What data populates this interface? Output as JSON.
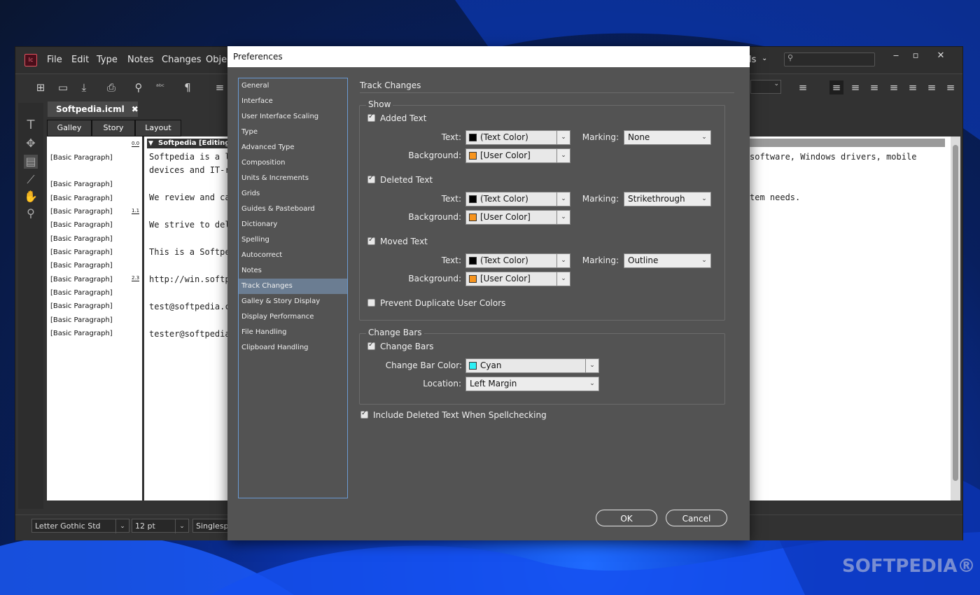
{
  "app": {
    "menu": [
      "File",
      "Edit",
      "Type",
      "Notes",
      "Changes",
      "Objec"
    ],
    "menu_right": "ls",
    "doc_tab": "Softpedia.icml",
    "view_tabs": [
      "Galley",
      "Story",
      "Layout"
    ]
  },
  "story": {
    "title": "Softpedia [Editing]",
    "styles": [
      "[Basic Paragraph]",
      "[Basic Paragraph]",
      "[Basic Paragraph]",
      "[Basic Paragraph]",
      "[Basic Paragraph]",
      "[Basic Paragraph]",
      "[Basic Paragraph]",
      "[Basic Paragraph]",
      "[Basic Paragraph]",
      "[Basic Paragraph]",
      "[Basic Paragraph]",
      "[Basic Paragraph]",
      "[Basic Paragraph]",
      "[Basic Paragraph]"
    ],
    "ruler_marks": [
      "0.0",
      "1.1",
      "2.3"
    ],
    "lines": [
      "Softpedia is a l",
      "devices and IT-r",
      "We review and ca",
      "We strive to del",
      "This is a Softpe",
      "http://win.softp",
      "test@softpedia.c",
      "tester@softpedia"
    ],
    "right_line_1": "software, Windows drivers, mobile",
    "right_line_2": "tem needs."
  },
  "statusbar": {
    "font": "Letter Gothic Std",
    "size": "12 pt",
    "spacing": "Singlespac"
  },
  "dialog": {
    "title": "Preferences",
    "categories": [
      "General",
      "Interface",
      "User Interface Scaling",
      "Type",
      "Advanced Type",
      "Composition",
      "Units & Increments",
      "Grids",
      "Guides & Pasteboard",
      "Dictionary",
      "Spelling",
      "Autocorrect",
      "Notes",
      "Track Changes",
      "Galley & Story Display",
      "Display Performance",
      "File Handling",
      "Clipboard Handling"
    ],
    "selected_category": "Track Changes",
    "pane_title": "Track Changes",
    "show": {
      "title": "Show",
      "added": {
        "label": "Added Text",
        "checked": true,
        "text_label": "Text:",
        "text_value": "(Text Color)",
        "text_swatch": "#000000",
        "marking_label": "Marking:",
        "marking_value": "None",
        "bg_label": "Background:",
        "bg_value": "[User Color]",
        "bg_swatch": "#f7941d"
      },
      "deleted": {
        "label": "Deleted Text",
        "checked": true,
        "text_label": "Text:",
        "text_value": "(Text Color)",
        "text_swatch": "#000000",
        "marking_label": "Marking:",
        "marking_value": "Strikethrough",
        "bg_label": "Background:",
        "bg_value": "[User Color]",
        "bg_swatch": "#f7941d"
      },
      "moved": {
        "label": "Moved Text",
        "checked": true,
        "text_label": "Text:",
        "text_value": "(Text Color)",
        "text_swatch": "#000000",
        "marking_label": "Marking:",
        "marking_value": "Outline",
        "bg_label": "Background:",
        "bg_value": "[User Color]",
        "bg_swatch": "#f7941d"
      },
      "prevent_dup": {
        "label": "Prevent Duplicate User Colors",
        "checked": false
      }
    },
    "change_bars": {
      "title": "Change Bars",
      "checkbox_label": "Change Bars",
      "checked": true,
      "color_label": "Change Bar Color:",
      "color_value": "Cyan",
      "color_swatch": "#2ef0f5",
      "location_label": "Location:",
      "location_value": "Left Margin"
    },
    "include_deleted": {
      "label": "Include Deleted Text When Spellchecking",
      "checked": true
    },
    "ok_label": "OK",
    "cancel_label": "Cancel"
  },
  "watermark": "SOFTPEDIA®"
}
